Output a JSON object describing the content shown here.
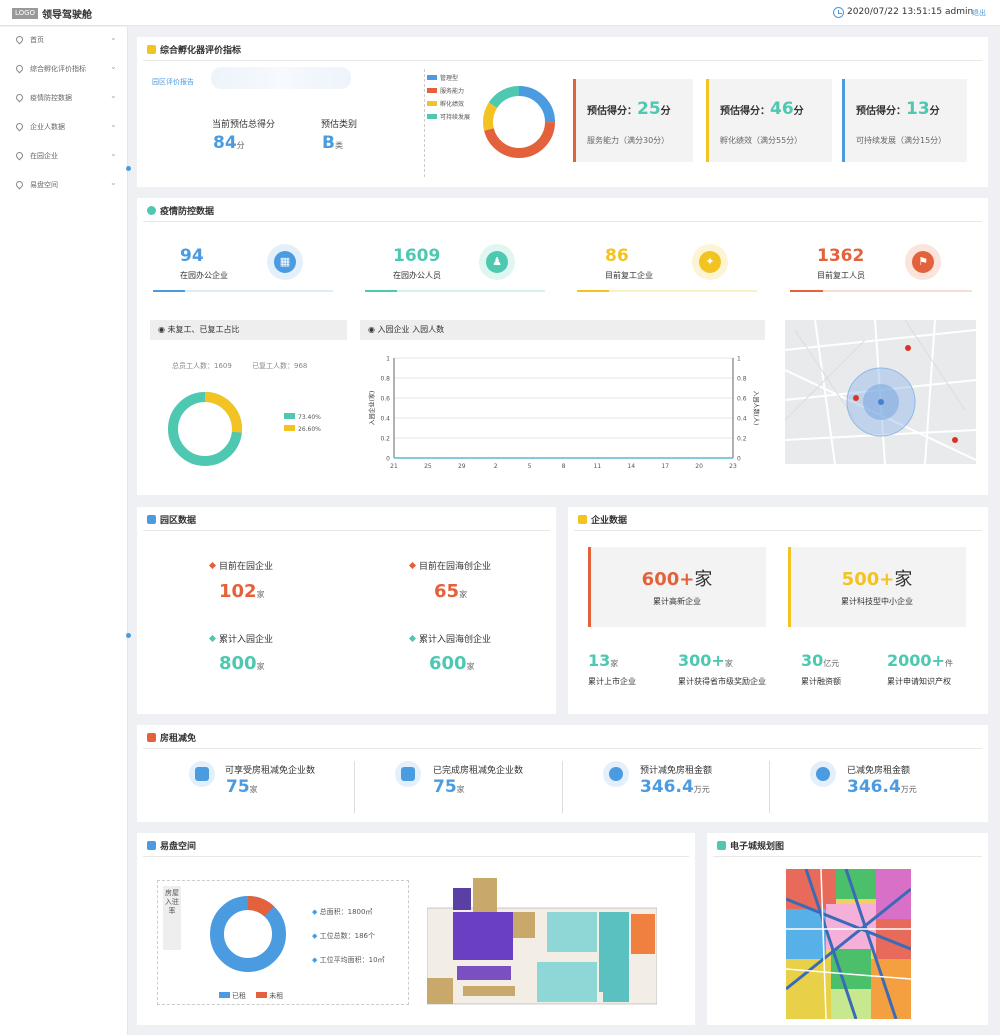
{
  "header": {
    "logo": "LOGO",
    "title": "领导驾驶舱",
    "datetime": "2020/07/22 13:51:15",
    "user": "admin",
    "logout": "退出"
  },
  "sidebar": {
    "items": [
      {
        "label": "首页"
      },
      {
        "label": "综合孵化评价指标"
      },
      {
        "label": "疫情防控数据"
      },
      {
        "label": "企业人数据"
      },
      {
        "label": "在园企业"
      },
      {
        "label": "易盘空间"
      }
    ]
  },
  "incubator": {
    "title": "综合孵化器评价指标",
    "report_link": "园区评价报告",
    "current_score_label": "当前预估总得分",
    "current_score": "84",
    "score_unit": "分",
    "category_label": "预估类别",
    "category": "B",
    "category_unit": "类",
    "donut_legend": [
      "管理型",
      "服务能力",
      "孵化绩效",
      "可持续发展"
    ],
    "donut_values": [
      25,
      46,
      13,
      16
    ],
    "cards": [
      {
        "title": "预估得分：",
        "value": "25",
        "unit": "分",
        "desc": "服务能力（满分30分）",
        "color": "#e4623b"
      },
      {
        "title": "预估得分：",
        "value": "46",
        "unit": "分",
        "desc": "孵化绩效（满分55分）",
        "color": "#f2c321"
      },
      {
        "title": "预估得分：",
        "value": "13",
        "unit": "分",
        "desc": "可持续发展（满分15分）",
        "color": "#4a9be0"
      }
    ]
  },
  "epidemic": {
    "title": "疫情防控数据",
    "stats": [
      {
        "value": "94",
        "label": "在园办公企业",
        "color": "#4a9be0",
        "progress": 0.18
      },
      {
        "value": "1609",
        "label": "在园办公人员",
        "color": "#4ec8b0",
        "progress": 0.18
      },
      {
        "value": "86",
        "label": "目前复工企业",
        "color": "#f2c321",
        "progress": 0.18
      },
      {
        "value": "1362",
        "label": "目前复工人员",
        "color": "#e4623b",
        "progress": 0.18
      }
    ],
    "ratio_title": "未复工、已复工占比",
    "total_workers_label": "总员工人数：",
    "total_workers": "1609",
    "returned_label": "已复工人数：",
    "returned": "968",
    "ratio_legend": [
      "73.40%",
      "26.60%"
    ],
    "entry_title": "入园企业   入园人数",
    "left_axis_label": "入园企业(家)",
    "right_axis_label": "入园人数(人)"
  },
  "park": {
    "title": "园区数据",
    "items": [
      {
        "label": "目前在园企业",
        "value": "102",
        "unit": "家",
        "color": "#e4623b"
      },
      {
        "label": "目前在园海创企业",
        "value": "65",
        "unit": "家",
        "color": "#e4623b"
      },
      {
        "label": "累计入园企业",
        "value": "800",
        "unit": "家",
        "color": "#4ec8b0"
      },
      {
        "label": "累计入园海创企业",
        "value": "600",
        "unit": "家",
        "color": "#4ec8b0"
      }
    ]
  },
  "enterprise": {
    "title": "企业数据",
    "cards": [
      {
        "value": "600+",
        "unit": "家",
        "label": "累计高新企业",
        "color": "#e4623b"
      },
      {
        "value": "500+",
        "unit": "家",
        "label": "累计科技型中小企业",
        "color": "#f2c321"
      }
    ],
    "stats": [
      {
        "value": "13",
        "unit": "家",
        "label": "累计上市企业"
      },
      {
        "value": "300+",
        "unit": "家",
        "label": "累计获得省市级奖励企业"
      },
      {
        "value": "30",
        "unit": "亿元",
        "label": "累计融资额"
      },
      {
        "value": "2000+",
        "unit": "件",
        "label": "累计申请知识产权"
      }
    ]
  },
  "rent": {
    "title": "房租减免",
    "items": [
      {
        "label": "可享受房租减免企业数",
        "value": "75",
        "unit": "家"
      },
      {
        "label": "已完成房租减免企业数",
        "value": "75",
        "unit": "家"
      },
      {
        "label": "预计减免房租金额",
        "value": "346.4",
        "unit": "万元"
      },
      {
        "label": "已减免房租金额",
        "value": "346.4",
        "unit": "万元"
      }
    ]
  },
  "space": {
    "title": "易盘空间",
    "side_label": "房屋入驻率",
    "donut_center": "88%",
    "total_area": "总面积：1800㎡",
    "total_stations": "工位总数：186个",
    "avg_area": "工位平均面积：10㎡",
    "legend": [
      "已租",
      "未租"
    ]
  },
  "city_map": {
    "title": "电子城规划图"
  },
  "chart_data": {
    "type": "line",
    "x": [
      "21",
      "25",
      "29",
      "2",
      "5",
      "8",
      "11",
      "14",
      "17",
      "20",
      "23"
    ],
    "series": [
      {
        "name": "入园企业",
        "values": [
          0,
          0,
          0,
          0,
          0,
          0,
          0,
          0,
          0,
          0,
          0
        ]
      },
      {
        "name": "入园人数",
        "values": [
          0,
          0,
          0,
          0,
          0,
          0,
          0,
          0,
          0,
          0,
          0
        ]
      }
    ],
    "ylabel": "入园企业(家)",
    "y2label": "入园人数(人)",
    "ylim": [
      0,
      1
    ],
    "y2lim": [
      0,
      1
    ],
    "yticks": [
      "0",
      "0.2",
      "0.4",
      "0.6",
      "0.8",
      "1"
    ],
    "grid": true
  }
}
